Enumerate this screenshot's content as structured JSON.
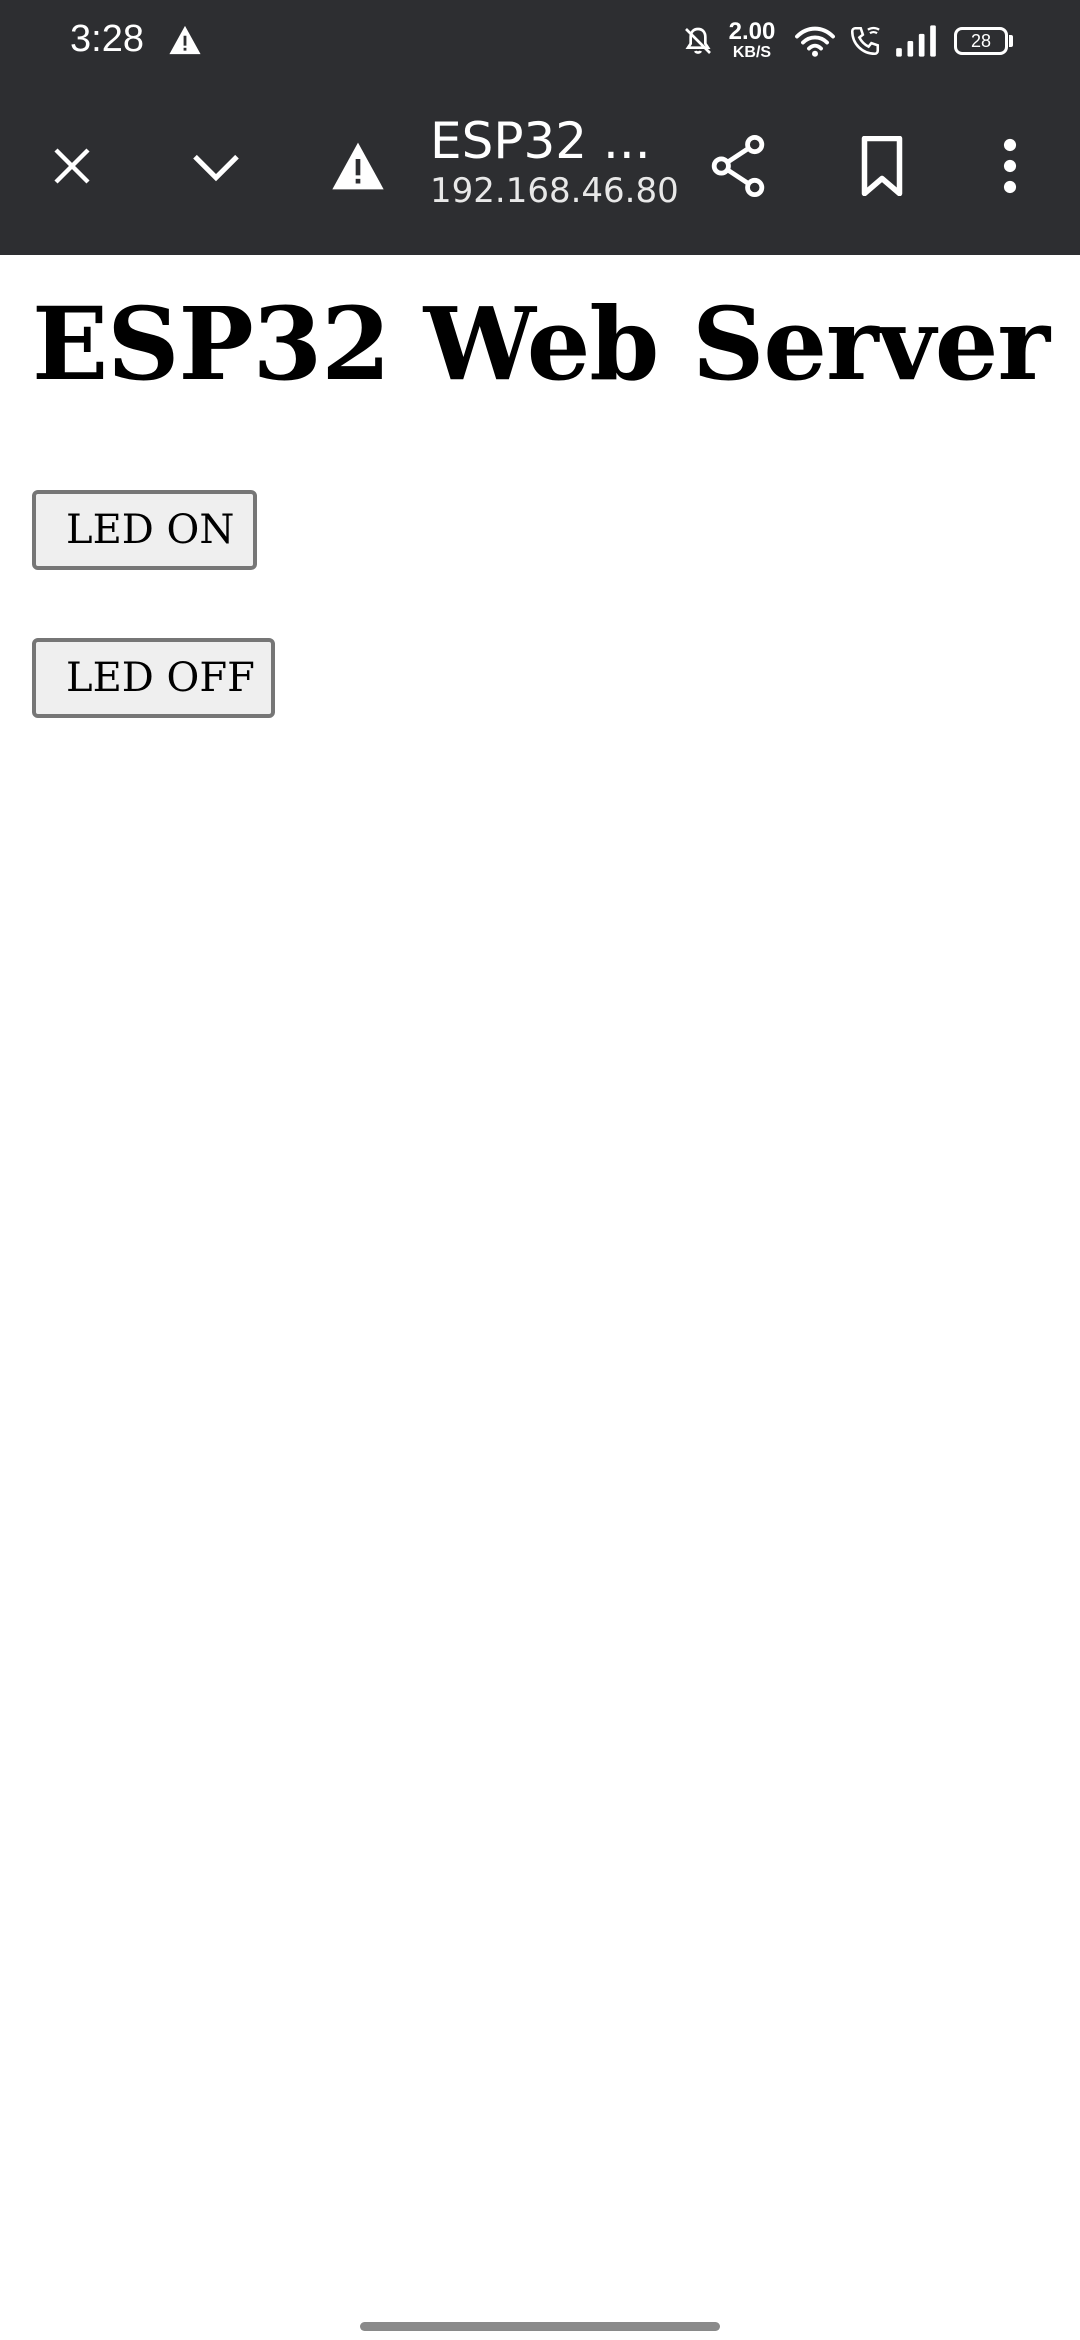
{
  "status_bar": {
    "time": "3:28",
    "net_speed_value": "2.00",
    "net_speed_unit": "KB/S",
    "battery_level": "28",
    "icons": [
      "warning-icon",
      "mute-icon",
      "wifi-icon",
      "wifi-call-icon",
      "signal-icon",
      "battery-icon"
    ]
  },
  "toolbar": {
    "title": "ESP32 ...",
    "url": "192.168.46.80",
    "icons": [
      "close-icon",
      "chevron-down-icon",
      "warning-icon",
      "share-icon",
      "bookmark-icon",
      "more-vert-icon"
    ]
  },
  "page": {
    "heading": "ESP32 Web Server",
    "led_on_label": "LED ON",
    "led_off_label": "LED OFF"
  },
  "colors": {
    "toolbar_bg": "#2d2e31",
    "page_bg": "#ffffff",
    "button_bg": "#efefef",
    "button_border": "#767676"
  }
}
